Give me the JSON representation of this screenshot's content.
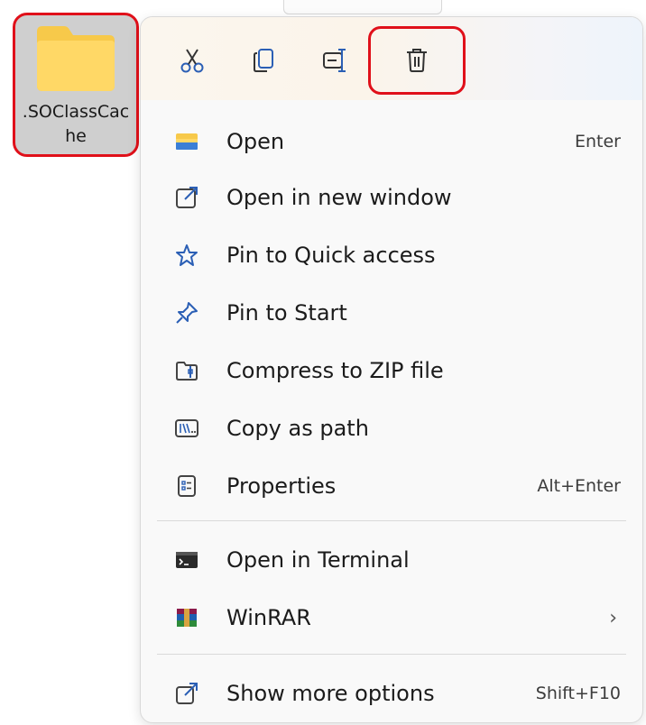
{
  "desktop": {
    "folder": {
      "name": ".SOClassCache",
      "icon": "folder-icon",
      "highlight_color": "#e0101a"
    }
  },
  "menu": {
    "toolbar": [
      {
        "id": "cut",
        "icon": "cut-icon"
      },
      {
        "id": "copy",
        "icon": "copy-icon"
      },
      {
        "id": "rename",
        "icon": "rename-icon"
      },
      {
        "id": "delete",
        "icon": "delete-icon"
      }
    ],
    "items": [
      {
        "label": "Open",
        "shortcut": "Enter",
        "icon": "folder-open-icon"
      },
      {
        "label": "Open in new window",
        "shortcut": "",
        "icon": "new-window-icon"
      },
      {
        "label": "Pin to Quick access",
        "shortcut": "",
        "icon": "star-icon"
      },
      {
        "label": "Pin to Start",
        "shortcut": "",
        "icon": "pin-icon"
      },
      {
        "label": "Compress to ZIP file",
        "shortcut": "",
        "icon": "zip-icon"
      },
      {
        "label": "Copy as path",
        "shortcut": "",
        "icon": "path-icon"
      },
      {
        "label": "Properties",
        "shortcut": "Alt+Enter",
        "icon": "properties-icon"
      }
    ],
    "secondary_items": [
      {
        "label": "Open in Terminal",
        "shortcut": "",
        "icon": "terminal-icon"
      },
      {
        "label": "WinRAR",
        "shortcut": "",
        "submenu": "›",
        "icon": "winrar-icon"
      }
    ],
    "footer_items": [
      {
        "label": "Show more options",
        "shortcut": "Shift+F10",
        "icon": "more-options-icon"
      }
    ]
  }
}
